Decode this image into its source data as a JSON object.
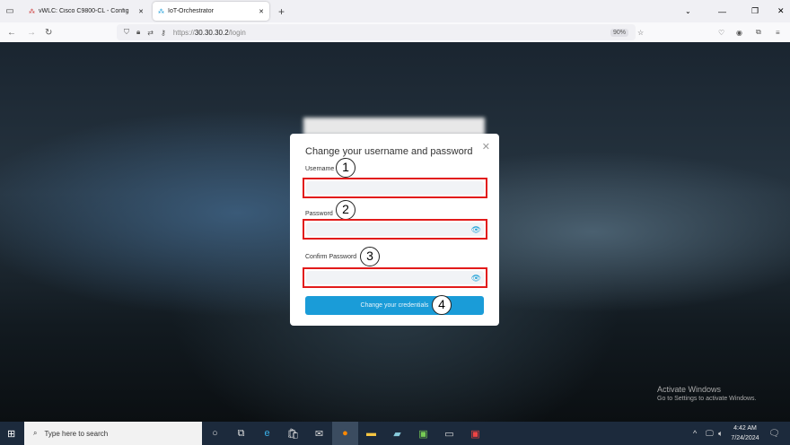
{
  "browser": {
    "tabs": [
      {
        "label": "vWLC: Cisco C9800-CL - Config",
        "active": false
      },
      {
        "label": "IoT-Orchestrator",
        "active": true
      }
    ],
    "url_prefix": "https://",
    "url_host": "30.30.30.2",
    "url_path": "/login",
    "zoom": "90%"
  },
  "dialog": {
    "title": "Change your username and password",
    "username_label": "Username",
    "password_label": "Password",
    "confirm_label": "Confirm Password",
    "username_value": "",
    "password_value": "",
    "confirm_value": "",
    "submit_label": "Change your credentials",
    "callouts": [
      "1",
      "2",
      "3",
      "4"
    ]
  },
  "watermark": {
    "title": "Activate Windows",
    "subtitle": "Go to Settings to activate Windows."
  },
  "taskbar": {
    "search_placeholder": "Type here to search",
    "time": "4:42 AM",
    "date": "7/24/2024"
  },
  "colors": {
    "accent": "#1a9cd8",
    "highlight": "#e21b1b"
  }
}
